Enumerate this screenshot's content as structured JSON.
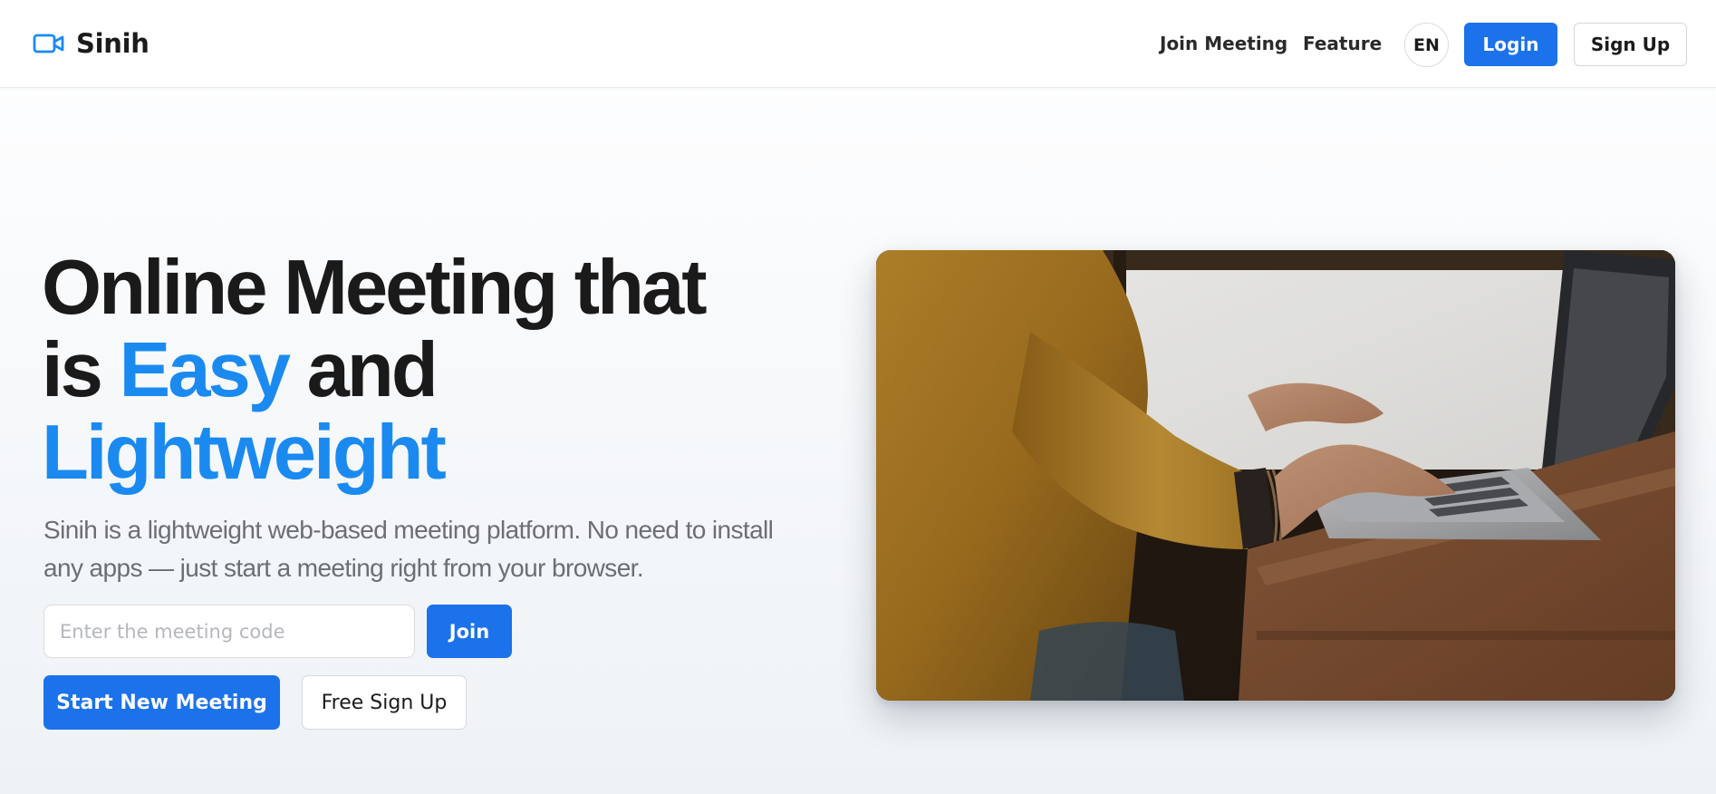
{
  "brand": {
    "name": "Sinih",
    "icon": "video-camera-icon",
    "color": "#1b8af0"
  },
  "nav": {
    "join_meeting": "Join Meeting",
    "feature": "Feature",
    "language": "EN",
    "login": "Login",
    "sign_up": "Sign Up"
  },
  "hero": {
    "title": {
      "line1": "Online Meeting that",
      "line2_prefix": "is ",
      "line2_accent": "Easy",
      "line2_suffix": " and",
      "line3_accent": "Lightweight"
    },
    "description": "Sinih is a lightweight web-based meeting platform. No need to install any apps — just start a meeting right from your browser.",
    "meeting_code": {
      "placeholder": "Enter the meeting code",
      "value": ""
    },
    "join_label": "Join",
    "start_meeting_label": "Start New Meeting",
    "free_signup_label": "Free Sign Up",
    "image": "person-typing-on-laptop-photo"
  },
  "colors": {
    "primary_button": "#1b72ea",
    "accent_text": "#1b8af0",
    "heading": "#1a1a1a",
    "body_text": "#6b6f75"
  }
}
